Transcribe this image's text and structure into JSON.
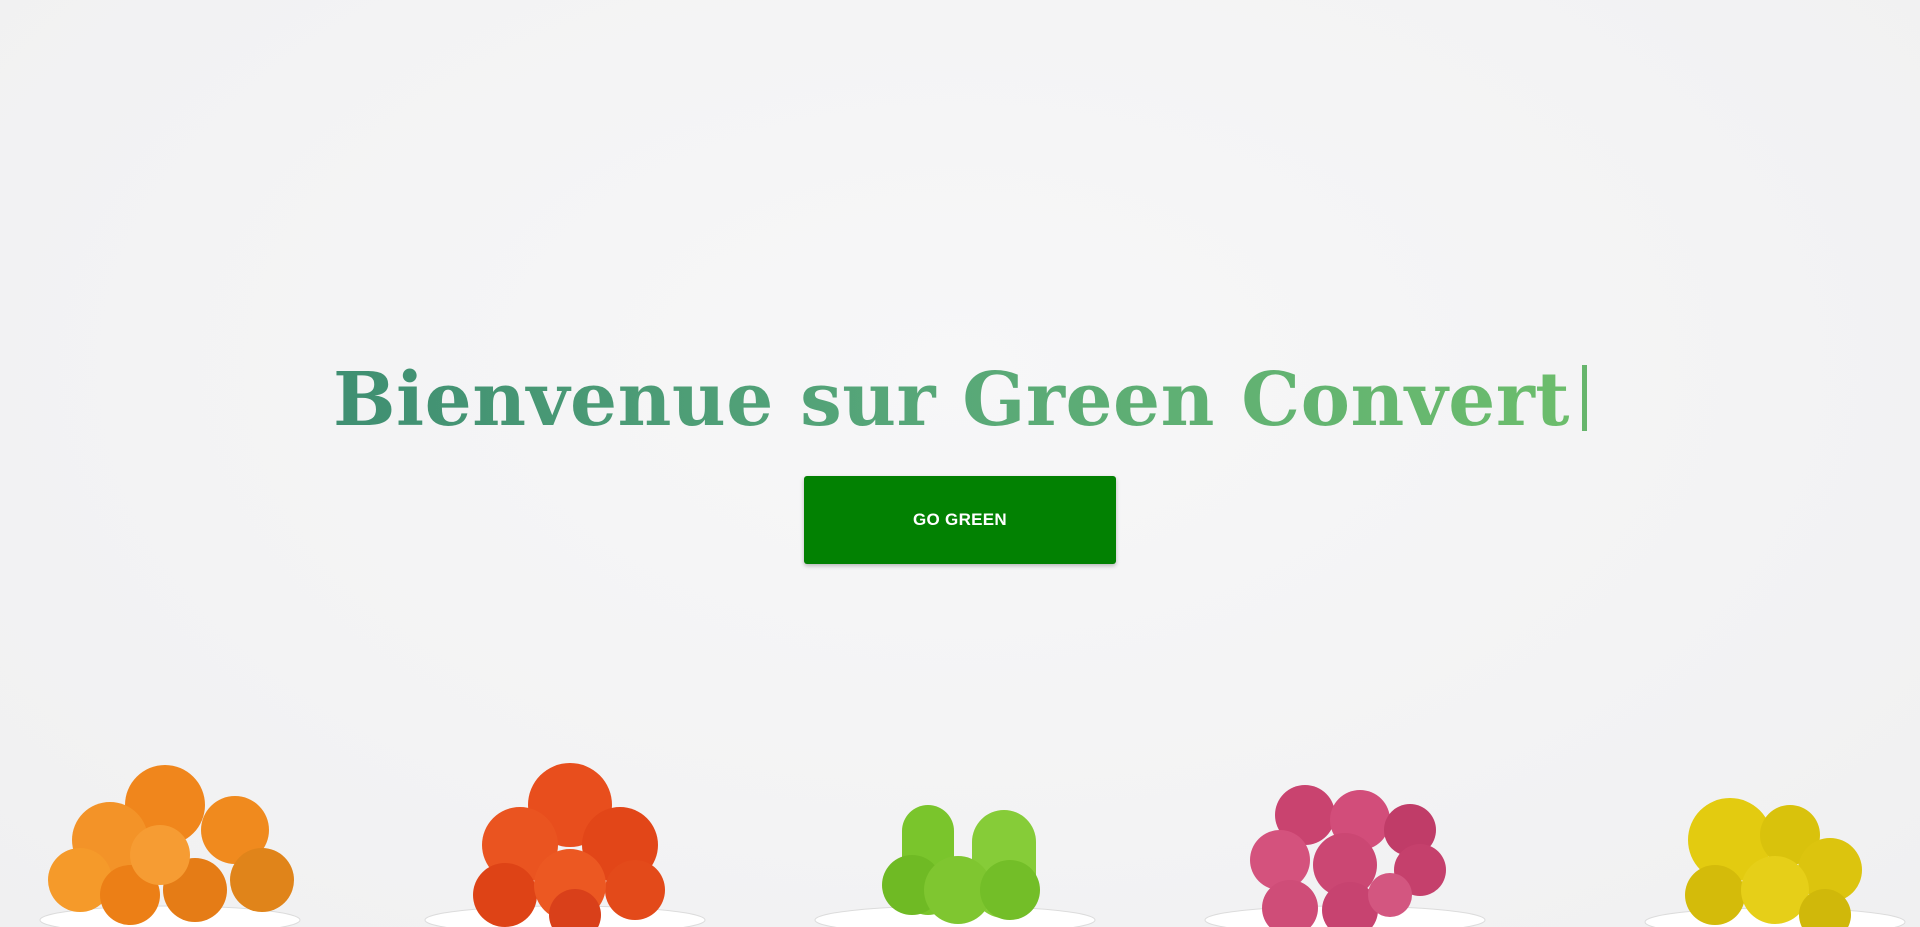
{
  "hero": {
    "title": "Bienvenue sur Green Convert",
    "cta_label": "GO GREEN"
  },
  "colors": {
    "background": "#f4f4f5",
    "title_gradient_start": "#3f8f72",
    "title_gradient_end": "#6cbd6c",
    "button": "#028102",
    "button_text": "#ffffff"
  },
  "decorations": {
    "cacti": [
      {
        "name": "orange-cactus",
        "color": "#f38a1c"
      },
      {
        "name": "red-cactus",
        "color": "#e6491a"
      },
      {
        "name": "green-cactus",
        "color": "#79c22a"
      },
      {
        "name": "pink-cactus",
        "color": "#cc3f6e"
      },
      {
        "name": "yellow-cactus",
        "color": "#e2c90f"
      }
    ]
  }
}
